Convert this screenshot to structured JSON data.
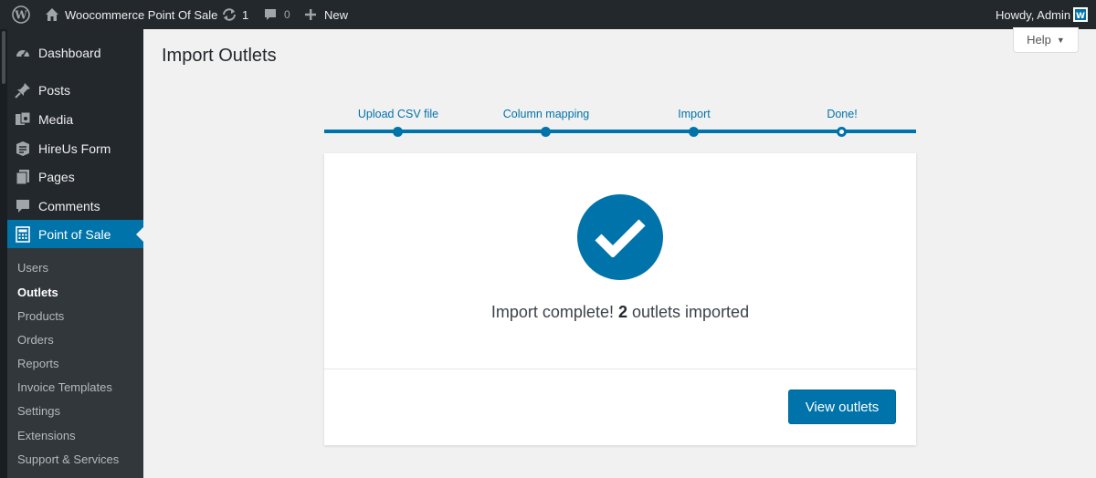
{
  "adminbar": {
    "site_name": "Woocommerce Point Of Sale",
    "updates_count": "1",
    "comments_count": "0",
    "new_label": "New",
    "howdy": "Howdy, Admin"
  },
  "sidebar": {
    "items": [
      {
        "label": "Dashboard",
        "icon": "dashboard-icon"
      },
      {
        "label": "Posts",
        "icon": "pin-icon"
      },
      {
        "label": "Media",
        "icon": "media-icon"
      },
      {
        "label": "HireUs Form",
        "icon": "form-icon"
      },
      {
        "label": "Pages",
        "icon": "pages-icon"
      },
      {
        "label": "Comments",
        "icon": "comment-icon"
      },
      {
        "label": "Point of Sale",
        "icon": "calculator-icon"
      }
    ],
    "submenu": [
      "Users",
      "Outlets",
      "Products",
      "Orders",
      "Reports",
      "Invoice Templates",
      "Settings",
      "Extensions",
      "Support & Services"
    ]
  },
  "page": {
    "title": "Import Outlets",
    "help_label": "Help"
  },
  "steps": [
    "Upload CSV file",
    "Column mapping",
    "Import",
    "Done!"
  ],
  "result": {
    "prefix": "Import complete!",
    "count": "2",
    "suffix": "outlets imported",
    "button_label": "View outlets"
  },
  "colors": {
    "accent": "#0073aa",
    "adminbar": "#23282d",
    "submenu": "#32373c"
  }
}
